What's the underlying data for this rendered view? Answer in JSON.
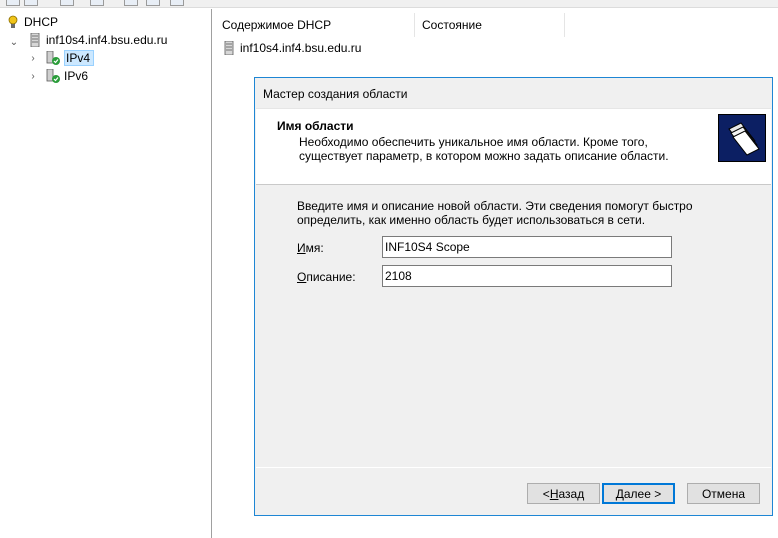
{
  "tree": {
    "root_label": "DHCP",
    "server_label": "inf10s4.inf4.bsu.edu.ru",
    "ipv4_label": "IPv4",
    "ipv6_label": "IPv6"
  },
  "list": {
    "columns": [
      "Содержимое DHCP",
      "Состояние"
    ],
    "rows": [
      {
        "name": "inf10s4.inf4.bsu.edu.ru",
        "status": ""
      }
    ]
  },
  "wizard": {
    "title": "Мастер создания области",
    "header_title": "Имя области",
    "header_desc": "Необходимо обеспечить уникальное имя области. Кроме того, существует параметр, в котором можно задать описание области.",
    "instructions": "Введите имя и описание новой области. Эти сведения помогут быстро определить, как именно область будет использоваться в сети.",
    "name_label_accel": "И",
    "name_label_rest": "мя:",
    "name_value": "INF10S4 Scope",
    "desc_label_accel": "О",
    "desc_label_rest": "писание:",
    "desc_value": "2108",
    "back_accel": "Н",
    "back_prefix": "< ",
    "back_rest": "азад",
    "next_accel": "Д",
    "next_rest": "алее >",
    "cancel_label": "Отмена"
  },
  "colors": {
    "accent": "#0078d7",
    "dialog_border": "#1e86d4",
    "selection": "#cce8ff",
    "header_icon_bg": "#0c1f63"
  }
}
